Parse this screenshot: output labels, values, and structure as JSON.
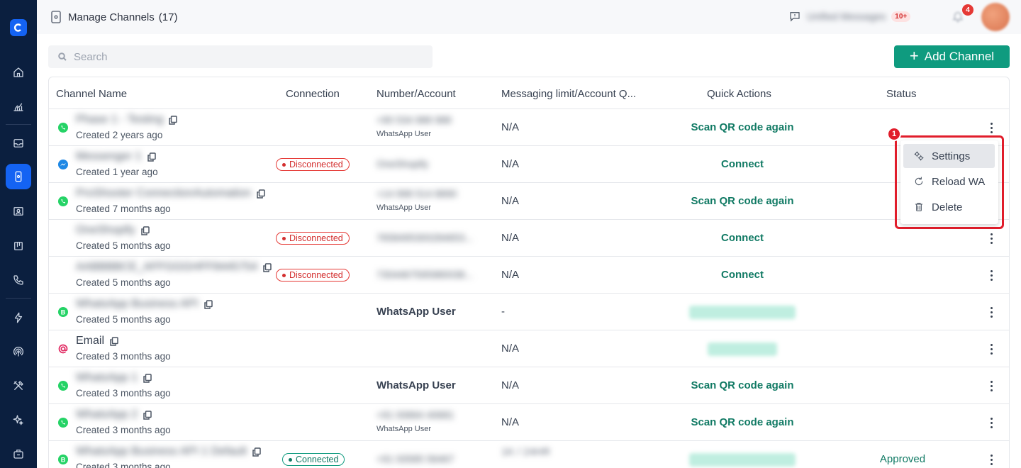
{
  "header": {
    "title": "Manage Channels",
    "count": "(17)",
    "unified_label": "Unified Messages",
    "unified_badge": "10+",
    "notification_count": "4"
  },
  "toolbar": {
    "search_placeholder": "Search",
    "add_label": "Add Channel"
  },
  "table": {
    "columns": [
      "Channel Name",
      "Connection",
      "Number/Account",
      "Messaging limit/Account Q...",
      "Quick Actions",
      "Status"
    ],
    "rows": [
      {
        "icon": "whatsapp-icon",
        "name": "Phase 1 - Testing",
        "blurred": true,
        "created": "Created 2 years ago",
        "connection": "",
        "number": "+90 534 988 988",
        "number_sub": "WhatsApp User",
        "limit": "N/A",
        "action": "Scan QR code again",
        "status": ""
      },
      {
        "icon": "messenger-icon",
        "name": "Messenger 1",
        "blurred": true,
        "created": "Created 1 year ago",
        "connection": "Disconnected",
        "number": "OneShopify",
        "number_sub": "",
        "limit": "N/A",
        "action": "Connect",
        "status": ""
      },
      {
        "icon": "whatsapp-icon",
        "name": "ProShooter ConnectionAutomation",
        "blurred": true,
        "created": "Created 7 months ago",
        "connection": "",
        "number": "+14 998 514 8890",
        "number_sub": "WhatsApp User",
        "limit": "N/A",
        "action": "Scan QR code again",
        "status": ""
      },
      {
        "icon": "",
        "name": "OneShopify",
        "blurred": true,
        "created": "Created 5 months ago",
        "connection": "Disconnected",
        "number": "7658495300284653...",
        "number_sub": "",
        "limit": "N/A",
        "action": "Connect",
        "status": ""
      },
      {
        "icon": "",
        "name": "AABBBBCE_AFFGGGHFF8445754",
        "blurred": true,
        "created": "Created 5 months ago",
        "connection": "Disconnected",
        "number": "7304467595980038...",
        "number_sub": "",
        "limit": "N/A",
        "action": "Connect",
        "status": ""
      },
      {
        "icon": "whatsapp-business-icon",
        "name": "WhatsApp Business API",
        "blurred": true,
        "created": "Created 5 months ago",
        "connection": "",
        "number": "WhatsApp User",
        "number_sub": "",
        "limit": "-",
        "action": "Select a plan below",
        "status": ""
      },
      {
        "icon": "email-icon",
        "name": "Email",
        "blurred": false,
        "created": "Created 3 months ago",
        "connection": "",
        "number": "",
        "number_sub": "",
        "limit": "N/A",
        "action": "Verify email",
        "status": ""
      },
      {
        "icon": "whatsapp-icon",
        "name": "WhatsApp 1",
        "blurred": true,
        "created": "Created 3 months ago",
        "connection": "",
        "number": "WhatsApp User",
        "number_sub": "",
        "limit": "N/A",
        "action": "Scan QR code again",
        "status": ""
      },
      {
        "icon": "whatsapp-icon",
        "name": "WhatsApp 2",
        "blurred": true,
        "created": "Created 3 months ago",
        "connection": "",
        "number": "+91 93664 40681",
        "number_sub": "WhatsApp User",
        "limit": "N/A",
        "action": "Scan QR code again",
        "status": ""
      },
      {
        "icon": "whatsapp-business-icon",
        "name": "WhatsApp Business API 1 Default",
        "blurred": true,
        "created": "Created 3 months ago",
        "connection": "Connected",
        "number": "+91 93585 56467",
        "number_sub": "",
        "limit": "1K / 24HR",
        "action": "Select a plan below",
        "status": "Approved"
      }
    ]
  },
  "menu": {
    "step": "1",
    "items": [
      {
        "label": "Settings",
        "icon": "settings-icon"
      },
      {
        "label": "Reload WA",
        "icon": "reload-icon"
      },
      {
        "label": "Delete",
        "icon": "trash-icon"
      }
    ]
  },
  "colors": {
    "sidebar": "#0b1f3f",
    "accent": "#0f9b7f",
    "active": "#1463f3",
    "danger": "#e53935"
  }
}
